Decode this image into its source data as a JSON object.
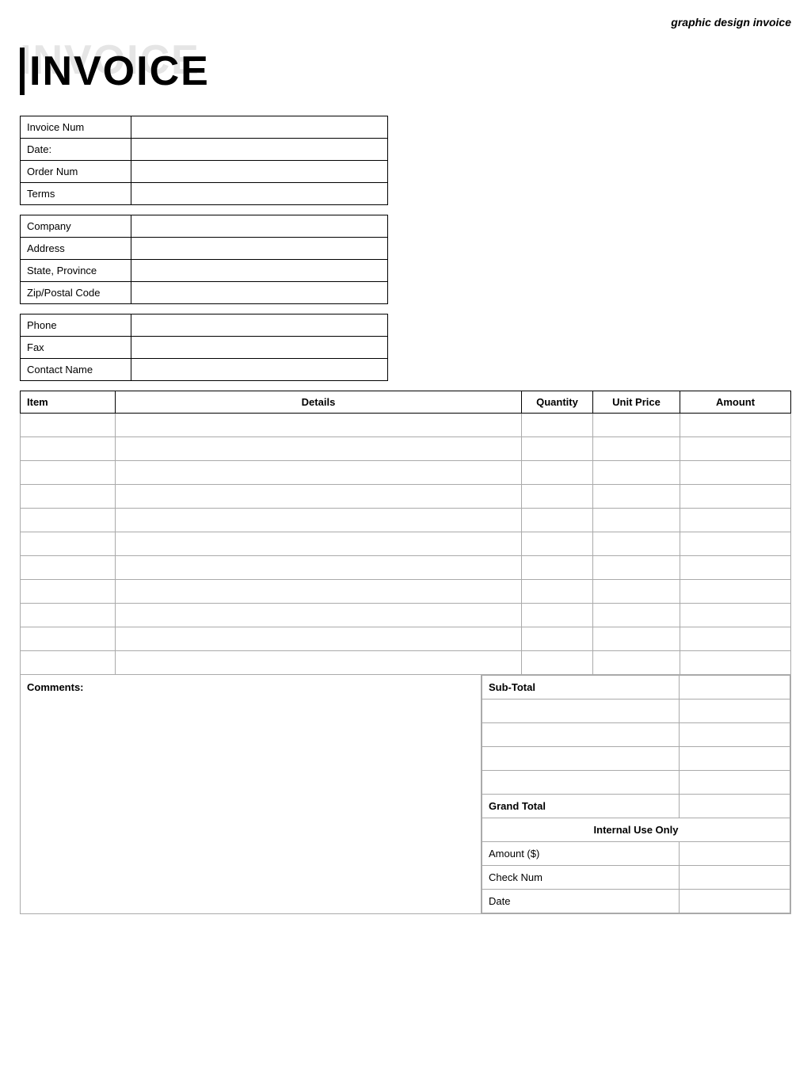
{
  "page": {
    "subtitle": "graphic design invoice"
  },
  "invoice_title": {
    "shadow_text": "INVOICE",
    "main_text": "INVOICE"
  },
  "invoice_info": {
    "rows": [
      {
        "label": "Invoice Num",
        "value": ""
      },
      {
        "label": "Date:",
        "value": ""
      },
      {
        "label": "Order Num",
        "value": ""
      },
      {
        "label": "Terms",
        "value": ""
      }
    ]
  },
  "company_info": {
    "rows": [
      {
        "label": "Company",
        "value": ""
      },
      {
        "label": "Address",
        "value": ""
      },
      {
        "label": "State, Province",
        "value": ""
      },
      {
        "label": "Zip/Postal Code",
        "value": ""
      }
    ]
  },
  "contact_info": {
    "rows": [
      {
        "label": "Phone",
        "value": ""
      },
      {
        "label": "Fax",
        "value": ""
      },
      {
        "label": "Contact Name",
        "value": ""
      }
    ]
  },
  "items_table": {
    "headers": {
      "item": "Item",
      "details": "Details",
      "quantity": "Quantity",
      "unit_price": "Unit Price",
      "amount": "Amount"
    },
    "rows": [
      {
        "item": "",
        "details": "",
        "quantity": "",
        "unit_price": "",
        "amount": ""
      },
      {
        "item": "",
        "details": "",
        "quantity": "",
        "unit_price": "",
        "amount": ""
      },
      {
        "item": "",
        "details": "",
        "quantity": "",
        "unit_price": "",
        "amount": ""
      },
      {
        "item": "",
        "details": "",
        "quantity": "",
        "unit_price": "",
        "amount": ""
      },
      {
        "item": "",
        "details": "",
        "quantity": "",
        "unit_price": "",
        "amount": ""
      },
      {
        "item": "",
        "details": "",
        "quantity": "",
        "unit_price": "",
        "amount": ""
      },
      {
        "item": "",
        "details": "",
        "quantity": "",
        "unit_price": "",
        "amount": ""
      },
      {
        "item": "",
        "details": "",
        "quantity": "",
        "unit_price": "",
        "amount": ""
      },
      {
        "item": "",
        "details": "",
        "quantity": "",
        "unit_price": "",
        "amount": ""
      },
      {
        "item": "",
        "details": "",
        "quantity": "",
        "unit_price": "",
        "amount": ""
      },
      {
        "item": "",
        "details": "",
        "quantity": "",
        "unit_price": "",
        "amount": ""
      }
    ]
  },
  "comments": {
    "label": "Comments:"
  },
  "totals": {
    "subtotal_label": "Sub-Total",
    "extra_rows": [
      "",
      "",
      "",
      ""
    ],
    "grand_total_label": "Grand Total",
    "internal_use_label": "Internal Use Only",
    "internal_rows": [
      {
        "label": "Amount ($)",
        "value": ""
      },
      {
        "label": "Check Num",
        "value": ""
      },
      {
        "label": "Date",
        "value": ""
      }
    ]
  }
}
